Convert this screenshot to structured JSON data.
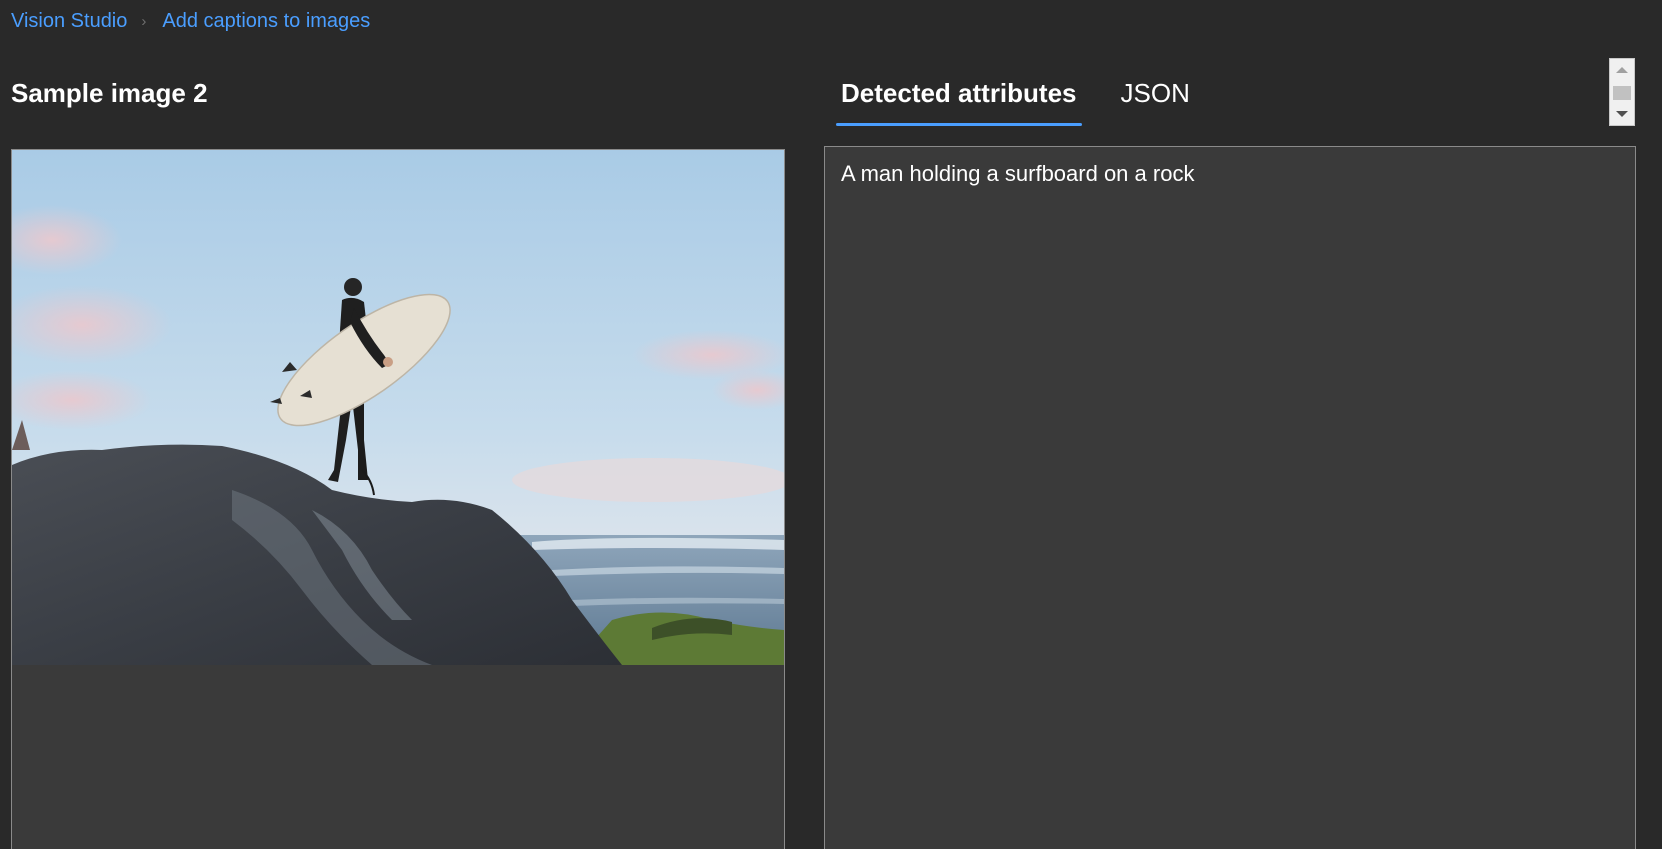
{
  "breadcrumb": {
    "items": [
      "Vision Studio",
      "Add captions to images"
    ],
    "separator": "›"
  },
  "sample": {
    "title": "Sample image 2",
    "image_alt": "Surfer holding a surfboard standing on a rock by the ocean"
  },
  "tabs": [
    {
      "label": "Detected attributes",
      "active": true
    },
    {
      "label": "JSON",
      "active": false
    }
  ],
  "result": {
    "caption": "A man holding a surfboard on a rock"
  },
  "colors": {
    "background": "#292929",
    "panel": "#3a3a3a",
    "accent": "#4a9eff"
  }
}
